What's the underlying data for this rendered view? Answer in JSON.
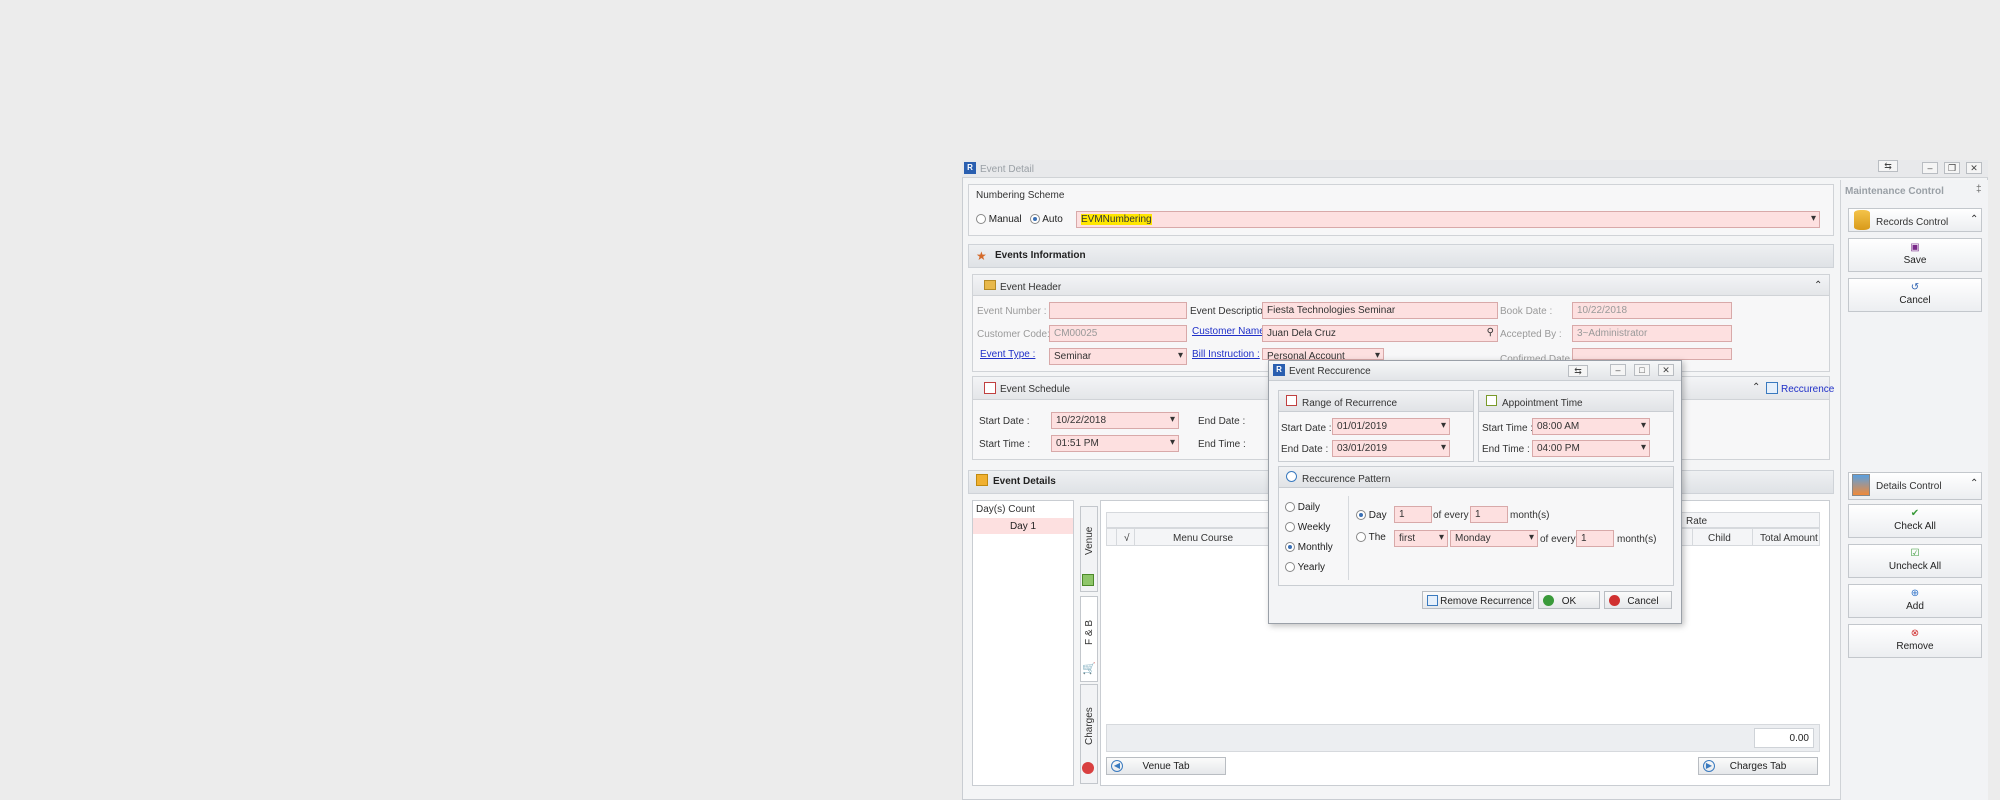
{
  "window": {
    "title": "Event Detail"
  },
  "numbering": {
    "group_title": "Numbering Scheme",
    "manual_label": "Manual",
    "auto_label": "Auto",
    "selected": "Auto",
    "scheme_value": "EVMNumbering"
  },
  "events_info": {
    "title": "Events Information"
  },
  "event_header": {
    "title": "Event Header",
    "event_number_label": "Event Number :",
    "event_number_value": "",
    "event_description_label": "Event Description :",
    "event_description_value": "Fiesta Technologies Seminar",
    "book_date_label": "Book Date :",
    "book_date_value": "10/22/2018",
    "customer_code_label": "Customer Code:",
    "customer_code_value": "CM00025",
    "customer_name_label": "Customer Name :",
    "customer_name_value": "Juan  Dela Cruz",
    "accepted_by_label": "Accepted By :",
    "accepted_by_value": "3~Administrator",
    "event_type_label": "Event Type :",
    "event_type_value": "Seminar",
    "bill_instruction_label": "Bill Instruction :",
    "bill_instruction_value": "Personal Account",
    "confirmed_date_label": "Confirmed Date :"
  },
  "event_schedule": {
    "title": "Event Schedule",
    "start_date_label": "Start Date :",
    "start_date_value": "10/22/2018",
    "start_time_label": "Start Time :",
    "start_time_value": "01:51 PM",
    "end_date_label": "End Date :",
    "end_time_label": "End Time :",
    "recurrence_link": "Reccurence"
  },
  "event_details": {
    "title": "Event Details",
    "days_header": "Day(s) Count",
    "days": [
      "Day 1"
    ],
    "tabs": [
      "Venue",
      "F & B",
      "Charges"
    ],
    "grid_headers": [
      "√",
      "Menu Course",
      "Rate",
      "Child",
      "Total Amount"
    ],
    "total_value": "0.00",
    "venue_tab_button": "Venue Tab",
    "charges_tab_button": "Charges Tab"
  },
  "maintenance": {
    "title": "Maintenance Control",
    "records_control": "Records Control",
    "save": "Save",
    "cancel": "Cancel",
    "details_control": "Details Control",
    "check_all": "Check All",
    "uncheck_all": "Uncheck All",
    "add": "Add",
    "remove": "Remove"
  },
  "dialog": {
    "title": "Event Reccurence",
    "range_title": "Range of Recurrence",
    "start_date_label": "Start Date :",
    "start_date_value": "01/01/2019",
    "end_date_label": "End Date :",
    "end_date_value": "03/01/2019",
    "appt_title": "Appointment Time",
    "start_time_label": "Start Time :",
    "start_time_value": "08:00 AM",
    "end_time_label": "End Time :",
    "end_time_value": "04:00 PM",
    "pattern_title": "Reccurence Pattern",
    "patterns": [
      "Daily",
      "Weekly",
      "Monthly",
      "Yearly"
    ],
    "selected_pattern": "Monthly",
    "day_option_label": "Day",
    "day_value": "1",
    "of_every_label": "of every",
    "every_months_value": "1",
    "months_label": "month(s)",
    "the_option_label": "The",
    "ordinal_value": "first",
    "weekday_value": "Monday",
    "every_months_value_2": "1",
    "remove_recurrence": "Remove Recurrence",
    "ok": "OK",
    "cancel": "Cancel"
  },
  "colors": {
    "field_bg": "#fde0e0",
    "highlight": "#ffe600",
    "link": "#2030c8"
  }
}
